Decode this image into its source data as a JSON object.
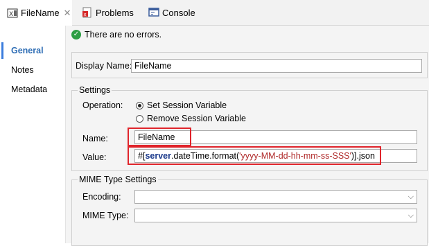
{
  "tabs": [
    {
      "label": "FileName",
      "icon": "filename-step-icon",
      "active": true,
      "closable": true
    },
    {
      "label": "Problems",
      "icon": "problems-icon"
    },
    {
      "label": "Console",
      "icon": "console-icon"
    }
  ],
  "sidebar": {
    "items": [
      {
        "label": "General",
        "active": true
      },
      {
        "label": "Notes"
      },
      {
        "label": "Metadata"
      }
    ]
  },
  "status": {
    "text": "There are no errors.",
    "icon": "check-circle-icon"
  },
  "display": {
    "label": "Display Name:",
    "value": "FileName"
  },
  "settings": {
    "title": "Settings",
    "operation_label": "Operation:",
    "options": [
      {
        "label": "Set Session Variable",
        "checked": true
      },
      {
        "label": "Remove Session Variable",
        "checked": false
      }
    ],
    "name_label": "Name:",
    "name_value": "FileName",
    "value_label": "Value:",
    "value_parts": {
      "prefix": "#[",
      "kw": "server",
      "mid": ".dateTime.format(",
      "str": "'yyyy-MM-dd-hh-mm-ss-SSS'",
      "suffix": ")].json"
    }
  },
  "mime": {
    "title": "MIME Type Settings",
    "encoding_label": "Encoding:",
    "encoding_value": "",
    "mimetype_label": "MIME Type:",
    "mimetype_value": ""
  },
  "colors": {
    "accent": "#2f6eb5",
    "highlight": "#e0242b",
    "ok": "#2e9e44"
  }
}
